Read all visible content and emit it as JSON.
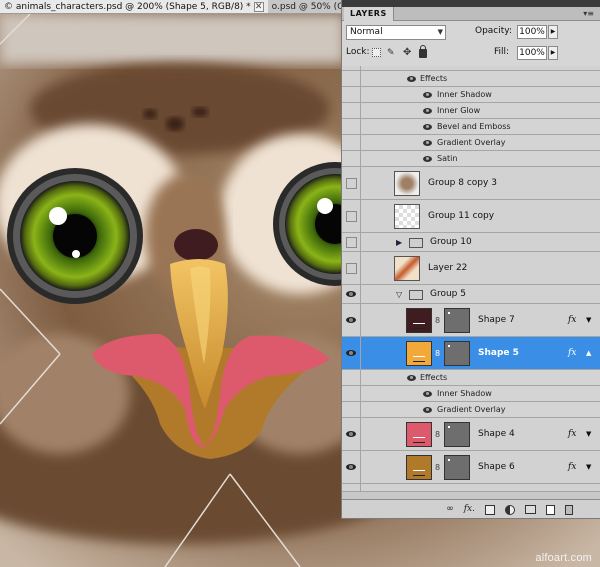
{
  "document_tabs": [
    {
      "label": "© animals_characters.psd @ 200% (Shape 5, RGB/8) *",
      "close": "✕"
    },
    {
      "label": "o.psd @ 50% (C"
    }
  ],
  "watermark": "alfoart.com",
  "layers_panel": {
    "title": "LAYERS",
    "blend_mode": "Normal",
    "opacity_label": "Opacity:",
    "opacity_value": "100%",
    "lock_label": "Lock:",
    "fill_label": "Fill:",
    "fill_value": "100%",
    "top_effects": {
      "header": "Effects",
      "items": [
        "Inner Shadow",
        "Inner Glow",
        "Bevel and Emboss",
        "Gradient Overlay",
        "Satin"
      ]
    },
    "layers_above": [
      {
        "name": "Group 8 copy 3",
        "visible": false
      },
      {
        "name": "Group 11 copy",
        "visible": false
      }
    ],
    "group_10": {
      "name": "Group 10",
      "visible": false
    },
    "layer_22": {
      "name": "Layer 22",
      "visible": false
    },
    "group_5": {
      "name": "Group 5",
      "visible": true
    },
    "shape_7": {
      "name": "Shape 7",
      "color": "#3f1c20",
      "fx": "fx"
    },
    "shape_5": {
      "name": "Shape 5",
      "color": "#f3a83a",
      "fx": "fx"
    },
    "shape_5_effects": {
      "header": "Effects",
      "items": [
        "Inner Shadow",
        "Gradient Overlay"
      ]
    },
    "shape_4": {
      "name": "Shape 4",
      "color": "#dc5a6c",
      "fx": "fx"
    },
    "shape_6": {
      "name": "Shape 6",
      "color": "#b07a2a",
      "fx": "fx"
    }
  },
  "colors": {
    "selection": "#3a8ee6",
    "panel_bg": "#d6d6d6"
  }
}
